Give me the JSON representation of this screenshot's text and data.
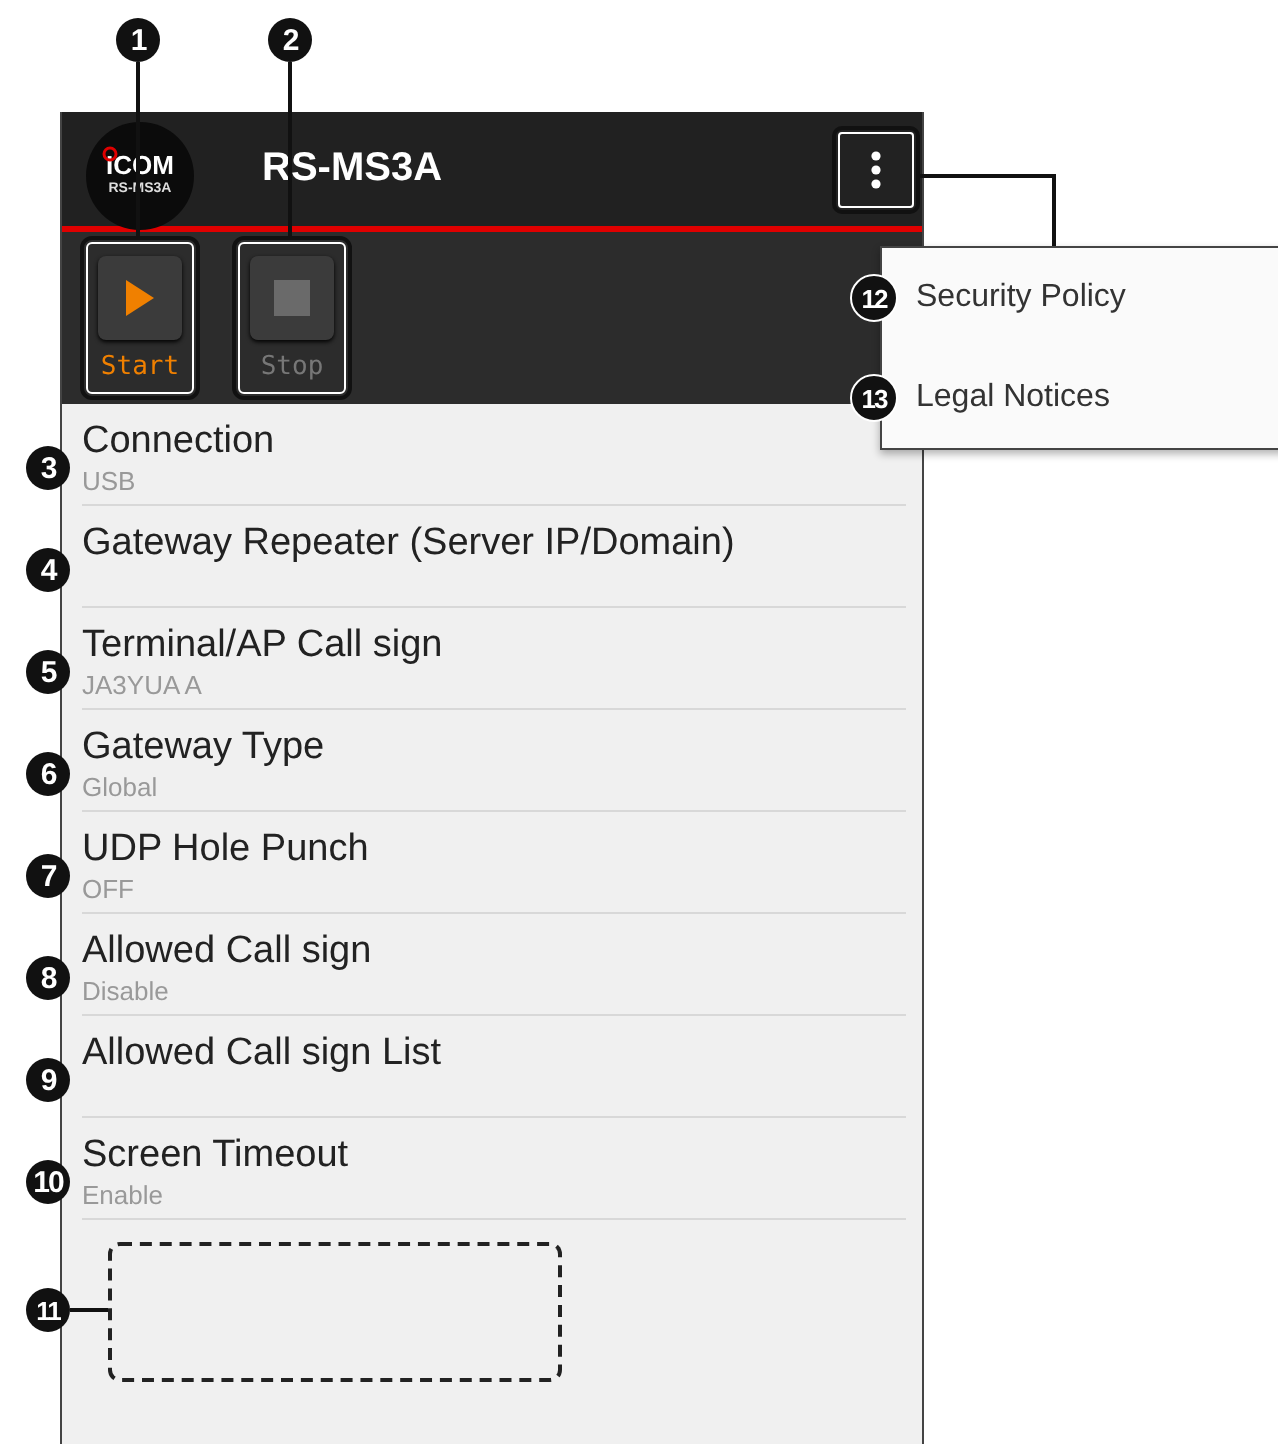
{
  "app_bar": {
    "logo": {
      "text": "ICOM",
      "subtext": "RS-MS3A"
    },
    "title": "RS-MS3A"
  },
  "toolbar": [
    {
      "kind": "start",
      "label": "Start",
      "disabled": false,
      "callout": "1"
    },
    {
      "kind": "stop",
      "label": "Stop",
      "disabled": true,
      "callout": "2"
    }
  ],
  "settings": [
    {
      "title": "Connection",
      "value": "USB",
      "callout": "3"
    },
    {
      "title": "Gateway Repeater (Server IP/Domain)",
      "callout": "4"
    },
    {
      "title": "Terminal/AP Call sign",
      "value": "JA3YUA A",
      "callout": "5"
    },
    {
      "title": "Gateway Type",
      "value": "Global",
      "callout": "6"
    },
    {
      "title": "UDP Hole Punch",
      "value": "OFF",
      "callout": "7"
    },
    {
      "title": "Allowed Call sign",
      "value": "Disable",
      "callout": "8"
    },
    {
      "title": "Allowed Call sign List",
      "callout": "9"
    },
    {
      "title": "Screen Timeout",
      "value": "Enable",
      "callout": "10"
    }
  ],
  "ad_area": {
    "callout": "11"
  },
  "menu": {
    "items": [
      {
        "label": "Security Policy",
        "callout": "12"
      },
      {
        "label": "Legal Notices",
        "callout": "13"
      }
    ]
  }
}
